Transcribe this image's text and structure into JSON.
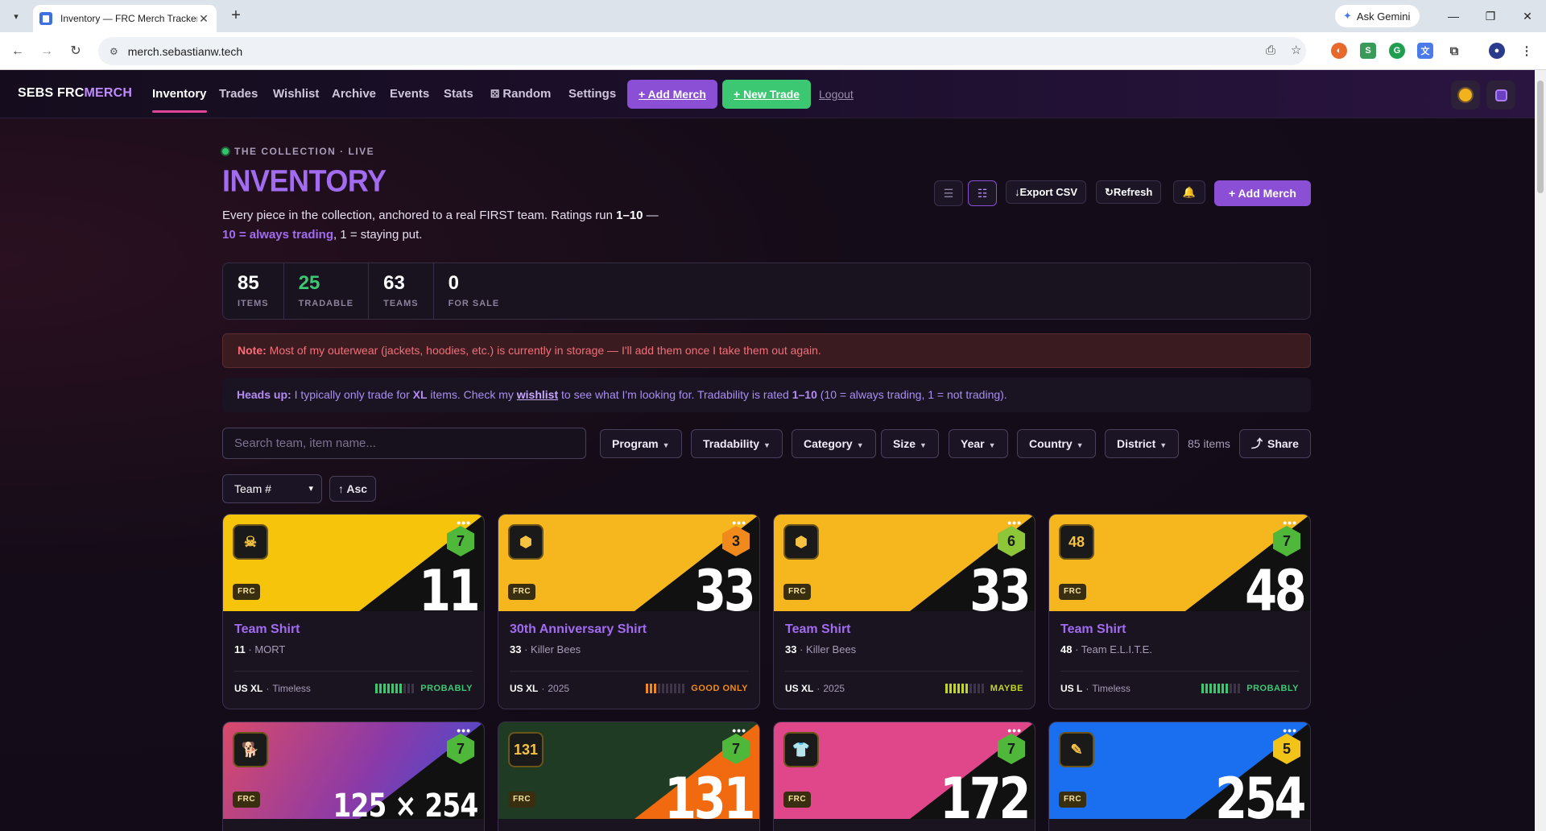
{
  "browser": {
    "tab_title": "Inventory — FRC Merch Tracker",
    "url": "merch.sebastianw.tech",
    "gemini_label": "Ask Gemini"
  },
  "nav": {
    "brand_a": "SEBS FRC",
    "brand_b": "MERCH",
    "links": [
      "Inventory",
      "Trades",
      "Wishlist",
      "Archive",
      "Events",
      "Stats",
      "Random",
      "Settings"
    ],
    "random_icon": "dice-icon",
    "add_merch": "+ Add Merch",
    "new_trade": "+ New Trade",
    "logout": "Logout"
  },
  "header": {
    "live_label": "THE COLLECTION · LIVE",
    "title": "INVENTORY",
    "desc_1": "Every piece in the collection, anchored to a real FIRST team. Ratings run ",
    "desc_range": "1–10",
    "desc_2": " —",
    "desc_hl": "10 = always trading",
    "desc_3": ", 1 = staying put.",
    "export_csv": "Export CSV",
    "refresh": "Refresh",
    "add_merch": "+ Add Merch"
  },
  "stats": [
    {
      "value": "85",
      "label": "ITEMS",
      "green": false
    },
    {
      "value": "25",
      "label": "TRADABLE",
      "green": true
    },
    {
      "value": "63",
      "label": "TEAMS",
      "green": false
    },
    {
      "value": "0",
      "label": "FOR SALE",
      "green": false
    }
  ],
  "note": {
    "label": "Note:",
    "text": " Most of my outerwear (jackets, hoodies, etc.) is currently in storage — I'll add them once I take them out again."
  },
  "headsup": {
    "label": "Heads up:",
    "t1": " I typically only trade for ",
    "size": "XL",
    "t2": " items. Check my ",
    "link": "wishlist",
    "t3": " to see what I'm looking for. Tradability is rated ",
    "range": "1–10",
    "t4": " (10 = always trading, 1 = not trading)."
  },
  "filters": {
    "search_placeholder": "Search team, item name...",
    "buttons": [
      "Program",
      "Tradability",
      "Category",
      "Size",
      "Year",
      "Country",
      "District"
    ],
    "count": "85 items",
    "share": "Share",
    "sort_value": "Team #",
    "asc": "↑ Asc"
  },
  "colors": {
    "accent_purple": "#8b4fd6",
    "accent_green": "#3cc873",
    "title_purple": "#a26cf0",
    "good_green": "#3cc873",
    "warn_orange": "#f08a1c",
    "maybe_yellow": "#c2d428"
  },
  "cards": [
    {
      "program": "FRC",
      "rating": "7",
      "team": "11",
      "team_name": "MORT",
      "item": "Team Shirt",
      "size": "US XL",
      "year": "Timeless",
      "status": "PROBABLY",
      "bars": 7,
      "banner": "#f5c40b",
      "hex": "#4fb83a",
      "status_color": "#3cc873",
      "logo_icon": "mort-logo-icon"
    },
    {
      "program": "FRC",
      "rating": "3",
      "team": "33",
      "team_name": "Killer Bees",
      "item": "30th Anniversary Shirt",
      "size": "US XL",
      "year": "2025",
      "status": "GOOD ONLY",
      "bars": 3,
      "banner": "#f6b71e",
      "hex": "#f08a1c",
      "status_color": "#f08a1c",
      "logo_icon": "bee-logo-icon"
    },
    {
      "program": "FRC",
      "rating": "6",
      "team": "33",
      "team_name": "Killer Bees",
      "item": "Team Shirt",
      "size": "US XL",
      "year": "2025",
      "status": "MAYBE",
      "bars": 6,
      "banner": "#f6b71e",
      "hex": "#8ec63a",
      "status_color": "#c2d428",
      "logo_icon": "bee-logo-icon"
    },
    {
      "program": "FRC",
      "rating": "7",
      "team": "48",
      "team_name": "Team E.L.I.T.E.",
      "item": "Team Shirt",
      "size": "US L",
      "year": "Timeless",
      "status": "PROBABLY",
      "bars": 7,
      "banner": "#f6b71e",
      "hex": "#4fb83a",
      "status_color": "#3cc873",
      "logo_icon": "elite-logo-icon"
    }
  ],
  "cards_row2": [
    {
      "program": "FRC",
      "rating": "7",
      "team": "125 × 254",
      "logo_icon": "dog-logo-icon"
    },
    {
      "program": "FRC",
      "rating": "7",
      "team": "131",
      "logo_icon": "chaos-logo-icon"
    },
    {
      "program": "FRC",
      "rating": "7",
      "team": "172",
      "logo_icon": "shirt-logo-icon"
    },
    {
      "program": "FRC",
      "rating": "5",
      "team": "254",
      "logo_icon": "cheesy-logo-icon"
    }
  ]
}
